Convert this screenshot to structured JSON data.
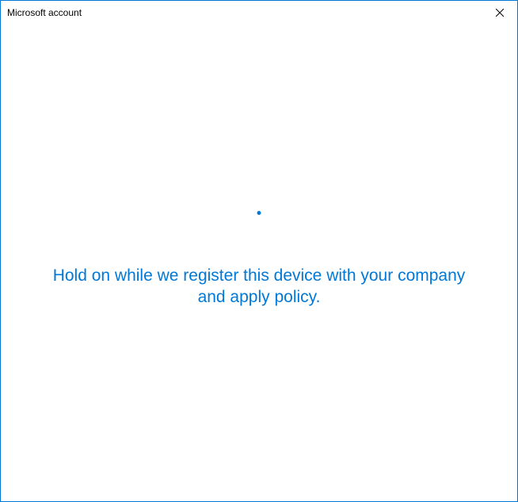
{
  "window": {
    "title": "Microsoft account"
  },
  "content": {
    "message": "Hold on while we register this device with your company and apply policy."
  },
  "colors": {
    "accent": "#0078d7"
  }
}
